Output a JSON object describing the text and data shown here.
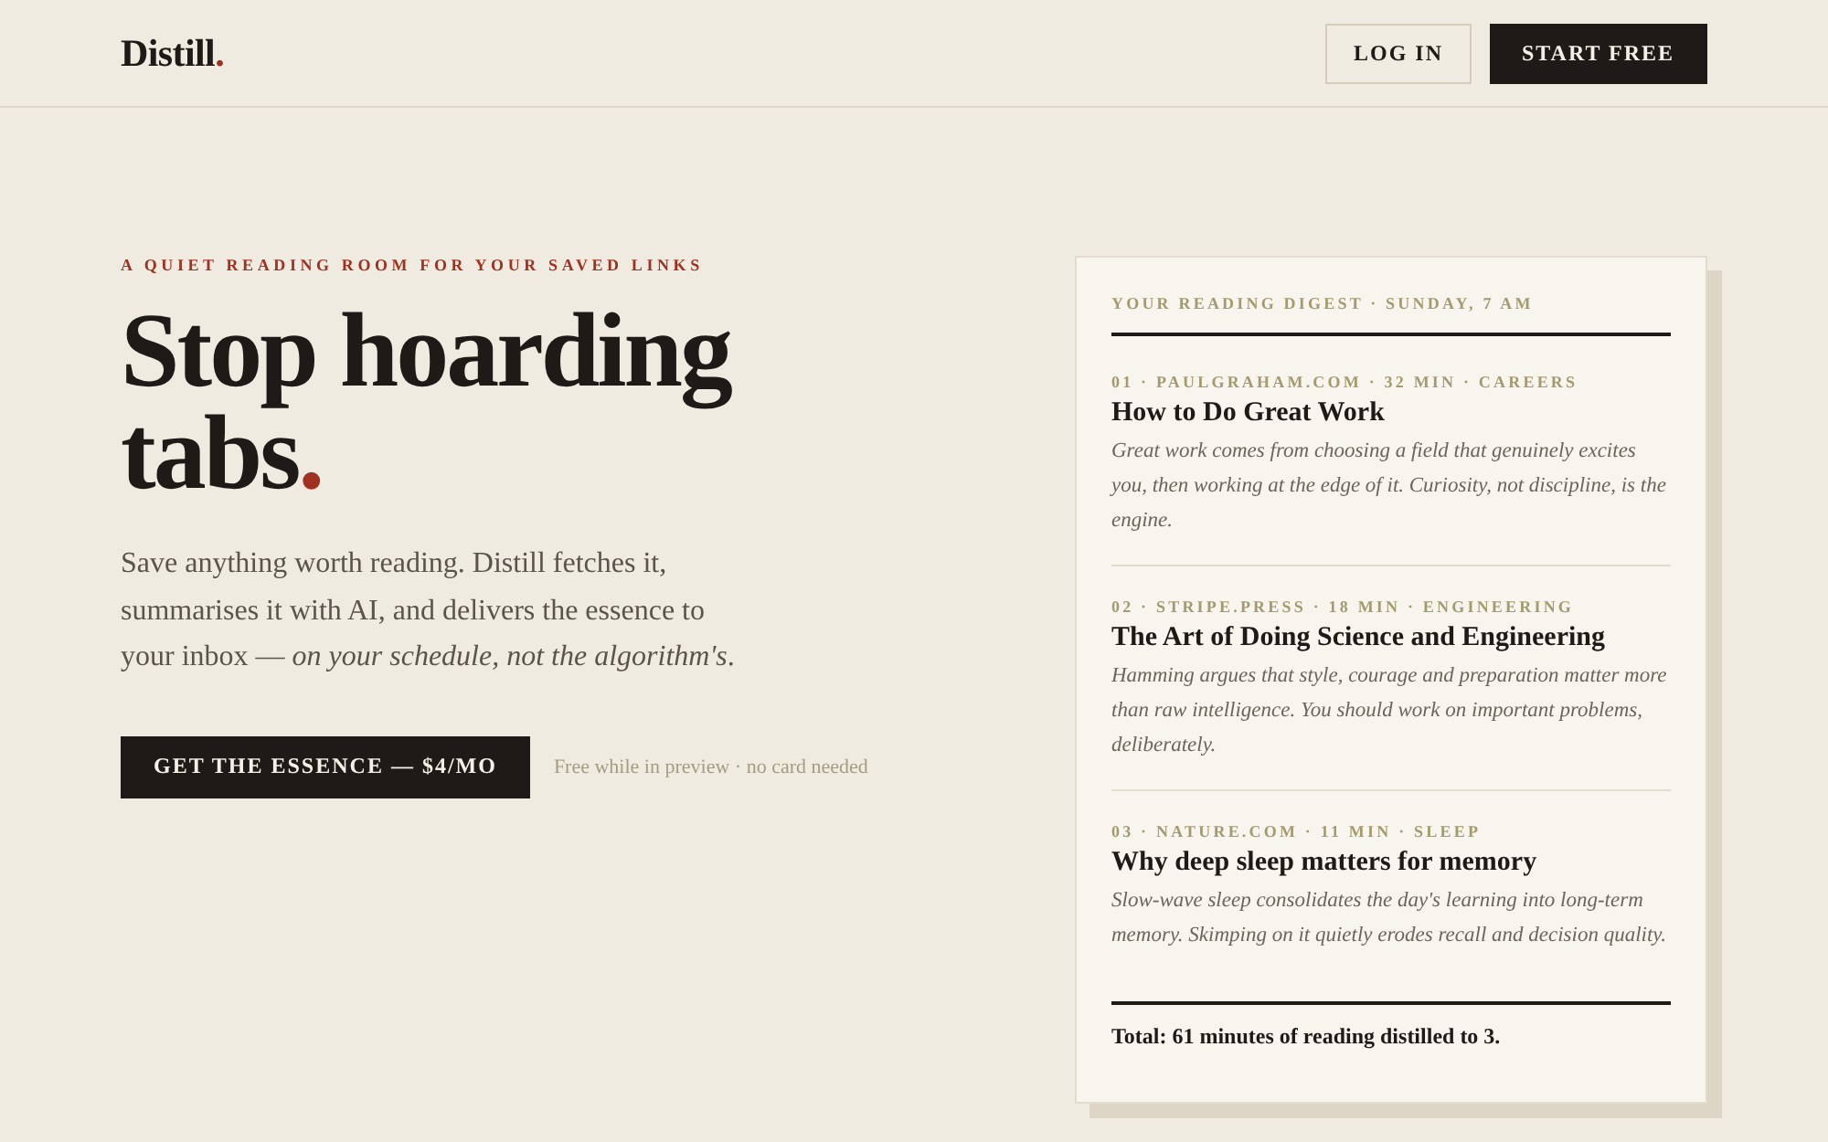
{
  "header": {
    "logo": {
      "text": "Distill",
      "mark": "."
    },
    "buttons": [
      {
        "label": "LOG IN",
        "kind": "outline"
      },
      {
        "label": "START FREE",
        "kind": "solid"
      }
    ]
  },
  "hero": {
    "eyebrow": "A QUIET READING ROOM FOR YOUR SAVED LINKS",
    "headline": {
      "text": "Stop hoarding tabs",
      "mark": "."
    },
    "body": "Save anything worth reading. Distill fetches it, summarises it with AI, and delivers the essence to your inbox — *on your schedule, not the algorithm's*.",
    "cta": "GET THE ESSENCE — $4/MO",
    "note": "Free while in preview · no card needed"
  },
  "digest": {
    "heading": "YOUR READING DIGEST · SUNDAY, 7 AM",
    "items": [
      {
        "meta": "01 · PAULGRAHAM.COM · 32 MIN · CAREERS",
        "title": "How to Do Great Work",
        "summary": "Great work comes from choosing a field that genuinely excites you, then working at the edge of it. Curiosity, not discipline, is the engine."
      },
      {
        "meta": "02 · STRIPE.PRESS · 18 MIN · ENGINEERING",
        "title": "The Art of Doing Science and Engineering",
        "summary": "Hamming argues that style, courage and preparation matter more than raw intelligence. You should work on important problems, deliberately."
      },
      {
        "meta": "03 · NATURE.COM · 11 MIN · SLEEP",
        "title": "Why deep sleep matters for memory",
        "summary": "Slow-wave sleep consolidates the day's learning into long-term memory. Skimping on it quietly erodes recall and decision quality."
      }
    ],
    "total": "Total: 61 minutes of reading distilled to 3."
  }
}
